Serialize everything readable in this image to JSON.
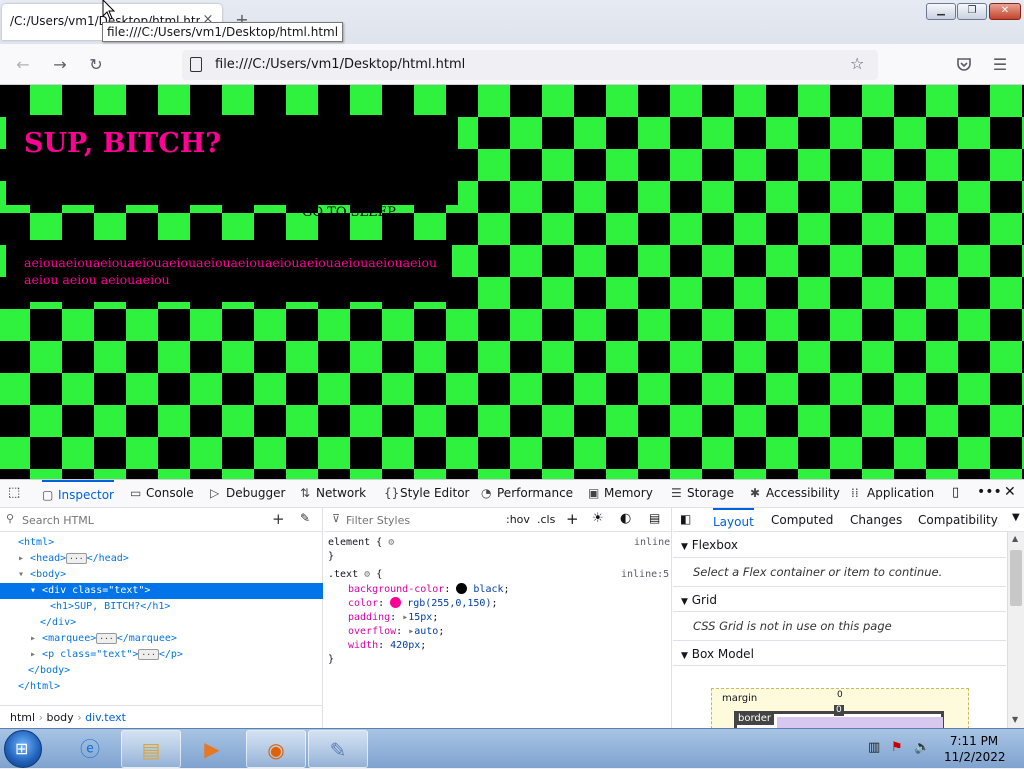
{
  "browser": {
    "tab_title": "/C:/Users/vm1/Desktop/html.html",
    "tab_close": "×",
    "new_tab": "+",
    "tooltip": "file:///C:/Users/vm1/Desktop/html.html",
    "url": "file:///C:/Users/vm1/Desktop/html.html",
    "window_controls": {
      "minimize": "▁",
      "maximize": "❐",
      "close": "✕"
    }
  },
  "page": {
    "heading": "SUP, BITCH?",
    "marquee": "GO TO SLEEP",
    "paragraph": "aeiouaeiouaeiouaeiouaeiouaeiouaeiouaeiouaeiouaeiouaeiouaeiou aeiou aeiou aeiouaeiou",
    "colors": {
      "green": "#2ff23f",
      "black": "#000000",
      "pink": "#ff0096"
    }
  },
  "devtools": {
    "tabs": [
      {
        "label": "Inspector",
        "icon": "inspector-icon"
      },
      {
        "label": "Console",
        "icon": "console-icon"
      },
      {
        "label": "Debugger",
        "icon": "debugger-icon"
      },
      {
        "label": "Network",
        "icon": "network-icon"
      },
      {
        "label": "Style Editor",
        "icon": "style-editor-icon"
      },
      {
        "label": "Performance",
        "icon": "performance-icon"
      },
      {
        "label": "Memory",
        "icon": "memory-icon"
      },
      {
        "label": "Storage",
        "icon": "storage-icon"
      },
      {
        "label": "Accessibility",
        "icon": "accessibility-icon"
      },
      {
        "label": "Application",
        "icon": "application-icon"
      }
    ],
    "search_html_placeholder": "Search HTML",
    "tree": {
      "html_open": "<html>",
      "head": "<head>",
      "head_close": "</head>",
      "body_open": "<body>",
      "div_open": "<div class=\"text\">",
      "h1": "<h1>SUP, BITCH?</h1>",
      "div_close": "</div>",
      "marquee_open": "<marquee>",
      "marquee_close": "</marquee>",
      "p_open": "<p class=\"text\">",
      "p_close": "</p>",
      "body_close": "</body>",
      "html_close": "</html>"
    },
    "breadcrumbs": [
      "html",
      "body",
      "div.text"
    ],
    "filter_styles_placeholder": "Filter Styles",
    "hov": ":hov",
    "cls": ".cls",
    "rules": {
      "element_selector": "element {",
      "element_close": "}",
      "element_source": "inline",
      "text_selector": ".text",
      "text_open": "{",
      "text_source": "inline:5",
      "declarations": [
        {
          "prop": "background-color",
          "value": "black",
          "swatch": "#000000"
        },
        {
          "prop": "color",
          "value": "rgb(255,0,150)",
          "swatch": "#ff0096"
        },
        {
          "prop": "padding",
          "value": "15px"
        },
        {
          "prop": "overflow",
          "value": "auto"
        },
        {
          "prop": "width",
          "value": "420px"
        }
      ],
      "text_close": "}"
    },
    "layout_tabs": [
      "Layout",
      "Computed",
      "Changes",
      "Compatibility"
    ],
    "flexbox_header": "Flexbox",
    "flexbox_msg": "Select a Flex container or item to continue.",
    "grid_header": "Grid",
    "grid_msg": "CSS Grid is not in use on this page",
    "box_model_header": "Box Model",
    "box_model": {
      "margin_label": "margin",
      "margin_top": "0",
      "border_label": "border",
      "border_top": "0"
    }
  },
  "taskbar": {
    "time": "7:11 PM",
    "date": "11/2/2022"
  }
}
